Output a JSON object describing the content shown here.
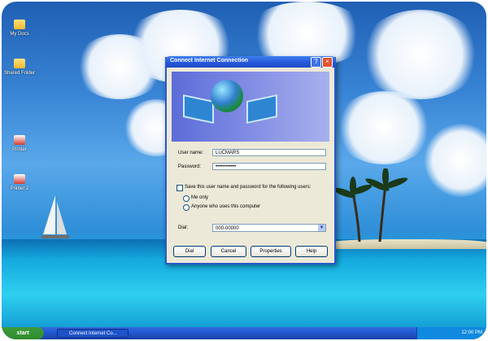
{
  "desktop": {
    "icons": [
      {
        "label": "My Docs",
        "icon": "folder-icon"
      },
      {
        "label": "Shared Folder",
        "icon": "folder-icon"
      },
      {
        "label": "Printer",
        "icon": "printer-icon"
      },
      {
        "label": "Printer 2",
        "icon": "printer-icon"
      }
    ]
  },
  "dialog": {
    "title": "Connect Internet Connection",
    "user_name_label": "User name:",
    "user_name_value": "LUCMARS",
    "password_label": "Password:",
    "password_value": "••••••••••••",
    "save_checkbox_label": "Save this user name and password for the following users:",
    "me_only_label": "Me only",
    "anyone_label": "Anyone who uses this computer",
    "dial_label": "Dial:",
    "dial_value": "000-00000",
    "buttons": {
      "dial": "Dial",
      "cancel": "Cancel",
      "properties": "Properties",
      "help": "Help"
    }
  },
  "taskbar": {
    "start_label": "start",
    "task_label": "Connect Internet Co...",
    "clock": "12:00 PM"
  },
  "colors": {
    "title_bar": "#2457d8",
    "start_green": "#2e8b2e",
    "dialog_bg": "#ece9d8"
  }
}
